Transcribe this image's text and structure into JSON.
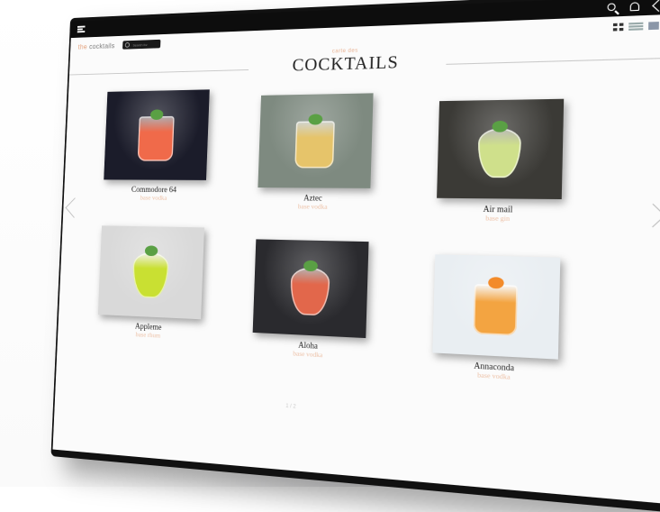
{
  "app": {
    "brand_prefix": "the",
    "brand": "cocktails",
    "search_placeholder": "Search for"
  },
  "header": {
    "kicker": "carte des",
    "title": "COCKTAILS"
  },
  "icons": [
    "menu-icon",
    "search-icon",
    "bell-icon",
    "back-icon",
    "grid-view-icon",
    "list-view-icon",
    "large-view-icon",
    "prev-arrow-icon",
    "next-arrow-icon"
  ],
  "cocktails": [
    {
      "name": "Commodore 64",
      "base": "base vodka",
      "bg": "#1b1c2a",
      "drink": "#f06a4a"
    },
    {
      "name": "Aztec",
      "base": "base vodka",
      "bg": "#7e8a80",
      "drink": "#e6c46a"
    },
    {
      "name": "Air mail",
      "base": "base gin",
      "bg": "#3b3a36",
      "drink": "#cfe08b"
    },
    {
      "name": "Appleme",
      "base": "base rhum",
      "bg": "#d9d9d9",
      "drink": "#c9e032"
    },
    {
      "name": "Aloha",
      "base": "base vodka",
      "bg": "#2a2a2e",
      "drink": "#e2674b"
    },
    {
      "name": "Annaconda",
      "base": "base vodka",
      "bg": "#e9eef2",
      "drink": "#f3a441"
    }
  ],
  "pager": "1 / 2",
  "colors": {
    "accent": "#e8b090",
    "topbar": "#0d0d0d"
  }
}
